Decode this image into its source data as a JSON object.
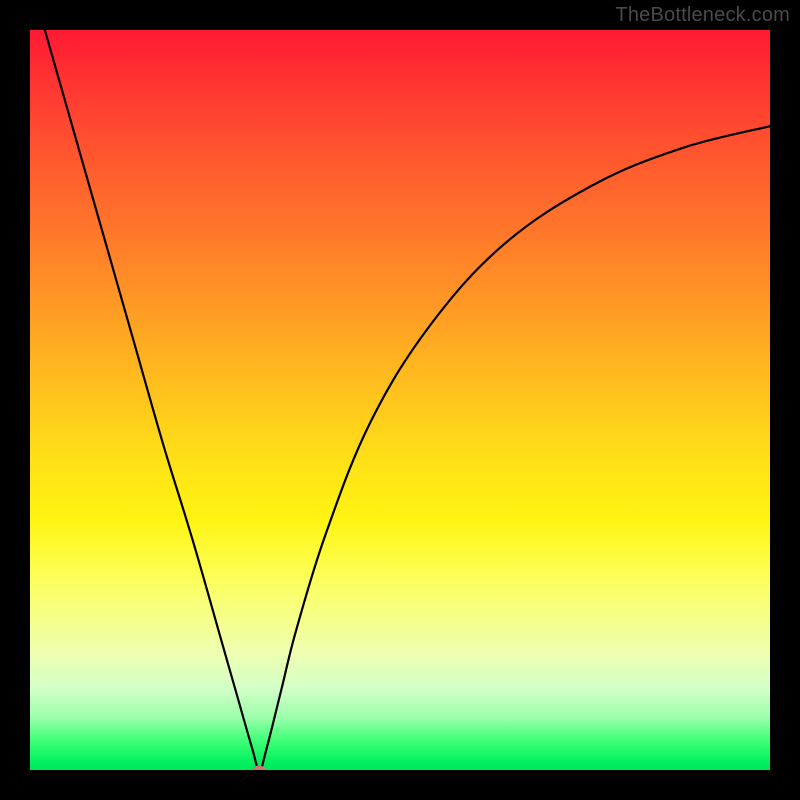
{
  "watermark": "TheBottleneck.com",
  "chart_data": {
    "type": "line",
    "title": "",
    "xlabel": "",
    "ylabel": "",
    "xlim": [
      0,
      100
    ],
    "ylim": [
      0,
      100
    ],
    "background_gradient": {
      "top_color": "#ff1a33",
      "mid_color": "#ffe017",
      "bottom_color": "#00e858"
    },
    "series": [
      {
        "name": "bottleneck-curve",
        "x": [
          2,
          6,
          10,
          14,
          18,
          22,
          26,
          28,
          30,
          31,
          32,
          34,
          36,
          40,
          46,
          54,
          64,
          76,
          88,
          100
        ],
        "values": [
          100,
          86,
          72,
          58,
          44,
          31,
          17,
          10,
          3,
          0,
          3,
          11,
          19,
          32,
          47,
          60,
          71,
          79,
          84,
          87
        ]
      }
    ],
    "marker": {
      "x": 31,
      "y": 0,
      "color": "#c97a6f"
    },
    "grid": false,
    "legend": false
  }
}
